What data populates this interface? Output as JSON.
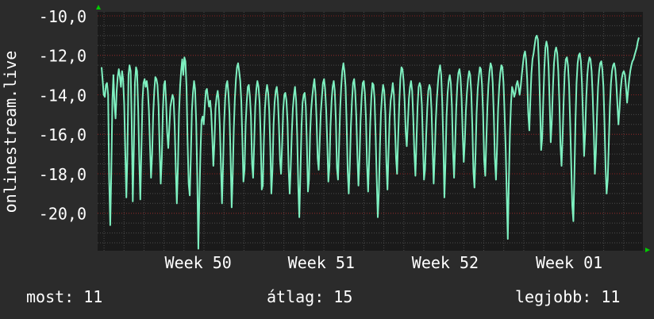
{
  "chart_data": {
    "type": "line",
    "ylabel": "onlinestream.live",
    "xlabel": "",
    "title": "",
    "yticks": [
      "-10,0",
      "-12,0",
      "-14,0",
      "-16,0",
      "-18,0",
      "-20,0"
    ],
    "ytick_values": [
      -10,
      -12,
      -14,
      -16,
      -18,
      -20
    ],
    "ylim": [
      -21.9,
      -9.8
    ],
    "xticks": [
      "Week 50",
      "Week 51",
      "Week 52",
      "Week 01"
    ],
    "xtick_values": [
      0.86,
      2.4,
      3.95,
      5.5
    ],
    "xlim": [
      -0.08,
      6.74
    ],
    "x_unit": "days",
    "grid": true,
    "series": [
      {
        "values": [
          -12.6,
          -13.3,
          -14.0,
          -14.1,
          -13.5,
          -13.4,
          -14.0,
          -18.2,
          -20.6,
          -18.0,
          -14.3,
          -13.0,
          -14.5,
          -15.2,
          -13.8,
          -13.1,
          -12.7,
          -13.1,
          -13.6,
          -12.8,
          -13.2,
          -14.5,
          -16.8,
          -19.2,
          -17.1,
          -13.0,
          -12.5,
          -12.8,
          -15.3,
          -19.4,
          -16.6,
          -13.4,
          -12.6,
          -12.8,
          -14.7,
          -17.2,
          -19.3,
          -16.9,
          -14.3,
          -13.4,
          -13.2,
          -13.6,
          -13.3,
          -13.8,
          -14.8,
          -16.6,
          -18.2,
          -17.0,
          -15.0,
          -13.8,
          -13.1,
          -13.2,
          -13.5,
          -14.6,
          -16.7,
          -18.5,
          -17.2,
          -14.8,
          -13.5,
          -13.3,
          -14.4,
          -15.9,
          -16.7,
          -15.7,
          -14.6,
          -14.3,
          -14.0,
          -14.2,
          -15.6,
          -17.8,
          -19.5,
          -17.6,
          -15.0,
          -13.6,
          -12.8,
          -12.2,
          -13.0,
          -12.1,
          -12.3,
          -13.6,
          -16.3,
          -18.5,
          -19.1,
          -17.2,
          -14.8,
          -13.9,
          -13.3,
          -13.7,
          -15.4,
          -18.1,
          -21.8,
          -19.2,
          -16.9,
          -15.3,
          -15.1,
          -15.5,
          -14.6,
          -13.8,
          -13.7,
          -14.2,
          -14.6,
          -14.3,
          -14.9,
          -16.2,
          -17.6,
          -16.4,
          -14.7,
          -14.1,
          -13.8,
          -14.3,
          -15.6,
          -17.5,
          -19.5,
          -17.6,
          -15.4,
          -14.2,
          -13.5,
          -13.3,
          -13.9,
          -14.9,
          -17.1,
          -19.7,
          -18.1,
          -15.7,
          -14.2,
          -13.2,
          -12.6,
          -12.4,
          -12.8,
          -13.3,
          -14.3,
          -16.3,
          -18.4,
          -17.8,
          -15.5,
          -14.4,
          -13.6,
          -13.5,
          -14.1,
          -15.1,
          -17.5,
          -18.2,
          -16.4,
          -14.6,
          -13.7,
          -13.3,
          -13.6,
          -14.4,
          -16.1,
          -18.8,
          -18.6,
          -16.3,
          -14.7,
          -13.9,
          -13.5,
          -13.9,
          -14.8,
          -16.7,
          -19.0,
          -17.8,
          -15.5,
          -14.4,
          -13.8,
          -13.6,
          -14.2,
          -15.5,
          -17.3,
          -18.0,
          -16.5,
          -14.8,
          -14.0,
          -13.9,
          -14.3,
          -15.4,
          -17.7,
          -19.0,
          -17.7,
          -15.9,
          -14.7,
          -14.0,
          -13.6,
          -14.3,
          -16.0,
          -18.6,
          -20.2,
          -18.0,
          -15.6,
          -14.4,
          -14.0,
          -13.9,
          -14.6,
          -16.4,
          -18.9,
          -18.3,
          -16.0,
          -14.8,
          -14.1,
          -13.6,
          -13.2,
          -13.9,
          -15.2,
          -17.2,
          -17.8,
          -16.3,
          -14.9,
          -14.1,
          -13.4,
          -13.2,
          -13.7,
          -14.8,
          -16.4,
          -18.4,
          -17.6,
          -15.6,
          -14.3,
          -13.6,
          -13.3,
          -13.8,
          -15.3,
          -17.7,
          -18.3,
          -16.6,
          -14.7,
          -13.6,
          -12.8,
          -12.4,
          -12.8,
          -13.6,
          -15.4,
          -17.9,
          -19.0,
          -17.5,
          -15.6,
          -14.3,
          -13.4,
          -13.2,
          -13.8,
          -15.1,
          -17.1,
          -18.6,
          -17.2,
          -15.3,
          -14.1,
          -13.4,
          -13.3,
          -13.9,
          -15.2,
          -17.5,
          -18.9,
          -17.3,
          -15.4,
          -14.1,
          -13.4,
          -13.5,
          -14.2,
          -16.1,
          -18.2,
          -20.2,
          -19.0,
          -16.6,
          -14.9,
          -14.0,
          -13.5,
          -13.8,
          -14.9,
          -17.4,
          -18.8,
          -17.0,
          -15.2,
          -14.3,
          -13.9,
          -13.4,
          -14.0,
          -15.6,
          -17.2,
          -18.0,
          -16.1,
          -14.4,
          -13.2,
          -12.6,
          -12.7,
          -13.3,
          -14.3,
          -15.9,
          -16.6,
          -15.4,
          -14.2,
          -13.6,
          -13.3,
          -13.8,
          -15.2,
          -16.9,
          -18.1,
          -16.4,
          -14.6,
          -13.6,
          -13.4,
          -13.6,
          -14.5,
          -16.3,
          -18.3,
          -17.8,
          -16.1,
          -14.7,
          -13.8,
          -13.5,
          -13.7,
          -14.8,
          -16.6,
          -18.5,
          -17.1,
          -15.3,
          -14.2,
          -13.4,
          -12.8,
          -12.5,
          -13.0,
          -14.4,
          -16.5,
          -19.2,
          -17.4,
          -15.1,
          -13.9,
          -13.3,
          -13.0,
          -13.4,
          -14.6,
          -16.8,
          -18.2,
          -16.5,
          -14.7,
          -13.5,
          -12.9,
          -12.7,
          -13.1,
          -14.2,
          -15.9,
          -17.4,
          -16.4,
          -14.8,
          -13.9,
          -13.2,
          -12.8,
          -13.0,
          -13.9,
          -15.6,
          -17.9,
          -18.7,
          -16.9,
          -14.9,
          -13.7,
          -13.1,
          -12.6,
          -12.7,
          -13.5,
          -15.0,
          -17.3,
          -18.1,
          -16.4,
          -14.6,
          -13.5,
          -12.8,
          -12.4,
          -12.6,
          -13.4,
          -15.1,
          -17.2,
          -18.3,
          -16.6,
          -14.7,
          -13.6,
          -12.9,
          -12.5,
          -12.6,
          -13.4,
          -14.9,
          -16.7,
          -18.9,
          -21.3,
          -18.4,
          -15.9,
          -14.4,
          -13.6,
          -13.8,
          -14.1,
          -13.9,
          -13.5,
          -13.3,
          -13.6,
          -14.0,
          -13.6,
          -13.0,
          -12.5,
          -12.0,
          -11.8,
          -12.2,
          -13.2,
          -14.9,
          -15.8,
          -14.3,
          -12.9,
          -12.2,
          -11.9,
          -11.5,
          -11.1,
          -11.0,
          -11.2,
          -12.5,
          -14.5,
          -16.8,
          -16.2,
          -14.3,
          -12.7,
          -11.6,
          -11.3,
          -11.6,
          -12.6,
          -14.5,
          -16.4,
          -15.3,
          -13.6,
          -12.4,
          -11.8,
          -11.6,
          -11.9,
          -12.8,
          -14.4,
          -16.5,
          -17.6,
          -16.2,
          -14.3,
          -12.9,
          -12.2,
          -12.1,
          -12.5,
          -13.5,
          -15.3,
          -17.5,
          -19.6,
          -20.4,
          -18.1,
          -15.3,
          -13.4,
          -12.4,
          -12.0,
          -11.9,
          -12.3,
          -13.4,
          -15.2,
          -17.1,
          -15.9,
          -14.2,
          -13.0,
          -12.4,
          -12.1,
          -12.2,
          -12.8,
          -14.0,
          -15.8,
          -18.0,
          -16.9,
          -15.0,
          -13.6,
          -12.8,
          -12.4,
          -12.3,
          -12.7,
          -13.6,
          -15.4,
          -17.7,
          -19.0,
          -18.3,
          -16.4,
          -14.6,
          -13.4,
          -12.8,
          -12.5,
          -12.4,
          -12.7,
          -13.4,
          -14.5,
          -15.5,
          -14.7,
          -13.8,
          -13.2,
          -12.9,
          -12.8,
          -13.0,
          -13.6,
          -14.4,
          -13.8,
          -13.2,
          -12.8,
          -12.5,
          -12.3,
          -12.2,
          -12.0,
          -11.8,
          -11.6,
          -11.3,
          -11.1
        ]
      }
    ]
  },
  "stats": {
    "now": "most: 11",
    "avg": "átlag: 15",
    "max": "legjobb: 11"
  },
  "colors": {
    "background": "#2b2b2b",
    "plot_background": "#1a1a1a",
    "grid_major": "#8a2020",
    "grid_minor": "#4a4a4a",
    "line": "#7ef0c0",
    "text": "#ffffff",
    "axis_arrow": "#00cc00"
  }
}
